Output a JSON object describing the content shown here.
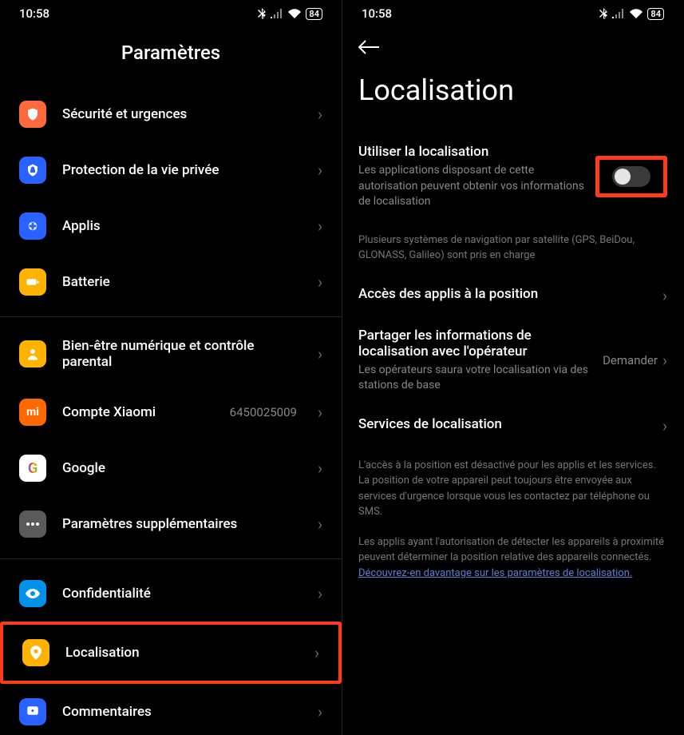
{
  "status": {
    "time": "10:58",
    "battery": "84"
  },
  "left": {
    "title": "Paramètres",
    "items": [
      {
        "label": "Sécurité et urgences",
        "icon": "shield",
        "color": "bg-orange"
      },
      {
        "label": "Protection de la vie privée",
        "icon": "privacy",
        "color": "bg-blue"
      },
      {
        "label": "Applis",
        "icon": "apps",
        "color": "bg-blue2"
      },
      {
        "label": "Batterie",
        "icon": "battery",
        "color": "bg-yellow"
      }
    ],
    "items2": [
      {
        "label": "Bien-être numérique et contrôle parental",
        "icon": "wellbeing",
        "color": "bg-yellow"
      },
      {
        "label": "Compte Xiaomi",
        "icon": "mi",
        "color": "bg-mi",
        "value": "6450025009"
      },
      {
        "label": "Google",
        "icon": "google",
        "color": "bg-white"
      },
      {
        "label": "Paramètres supplémentaires",
        "icon": "more",
        "color": "bg-grey"
      }
    ],
    "items3": [
      {
        "label": "Confidentialité",
        "icon": "eye",
        "color": "bg-lblue"
      },
      {
        "label": "Localisation",
        "icon": "location",
        "color": "bg-yellow",
        "highlight": true
      },
      {
        "label": "Commentaires",
        "icon": "feedback",
        "color": "bg-blue3"
      }
    ]
  },
  "right": {
    "title": "Localisation",
    "use_location": {
      "title": "Utiliser la localisation",
      "desc": "Les applications disposant de cette autorisation peuvent obtenir vos informations de localisation"
    },
    "satellite_info": "Plusieurs systèmes de navigation par satellite (GPS, BeiDou, GLONASS, Galileo) sont pris en charge",
    "app_access": "Accès des applis à la position",
    "share_operator": {
      "title": "Partager les informations de localisation avec l'opérateur",
      "desc": "Les opérateurs saura votre localisation via des stations de base",
      "value": "Demander"
    },
    "location_services": "Services de localisation",
    "footer1": "L'accès à la position est désactivé pour les applis et les services. La position de votre appareil peut toujours être envoyée aux services d'urgence lorsque vous les contactez par téléphone ou SMS.",
    "footer2": "Les applis ayant l'autorisation de détecter les appareils à proximité peuvent déterminer la position relative des appareils connectés.",
    "footer_link": "Découvrez-en davantage sur les paramètres de localisation."
  }
}
